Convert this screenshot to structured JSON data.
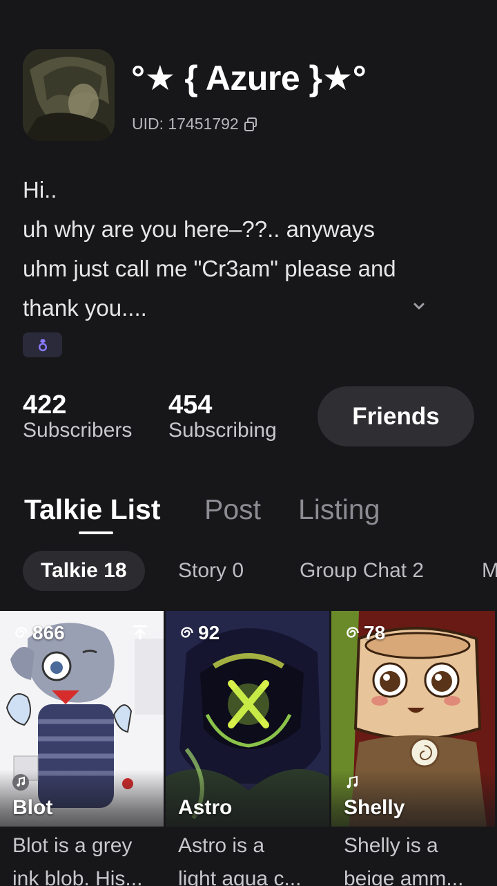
{
  "profile": {
    "name": "°★ { Azure }★°",
    "uid": "UID: 17451792",
    "bio_lines": [
      "Hi..",
      "uh why are you here–??.. anyways",
      "uhm just call me \"Cr3am\" please and",
      "thank you...."
    ]
  },
  "stats": [
    {
      "value": "422",
      "label": "Subscribers"
    },
    {
      "value": "454",
      "label": "Subscribing"
    }
  ],
  "friends_button": "Friends",
  "tabs": [
    {
      "label": "Talkie List",
      "active": true
    },
    {
      "label": "Post",
      "active": false
    },
    {
      "label": "Listing",
      "active": false
    }
  ],
  "chips": [
    {
      "label": "Talkie 18",
      "active": true
    },
    {
      "label": "Story 0",
      "active": false
    },
    {
      "label": "Group Chat 2",
      "active": false
    },
    {
      "label": "M",
      "active": false
    }
  ],
  "cards": [
    {
      "views": "866",
      "name": "Blot",
      "desc_lines": [
        "Blot is a grey",
        "ink blob. His..."
      ],
      "has_music": true,
      "pinned": true
    },
    {
      "views": "92",
      "name": "Astro",
      "desc_lines": [
        "Astro is a",
        "light aqua c..."
      ],
      "has_music": false,
      "pinned": false
    },
    {
      "views": "78",
      "name": "Shelly",
      "desc_lines": [
        "Shelly is a",
        "beige amm..."
      ],
      "has_music": true,
      "pinned": false
    }
  ],
  "colors": {
    "background": "#17171a",
    "button": "#2e2e33",
    "badge_icon": "#8a7cff"
  },
  "icons": {
    "copy": "copy-icon",
    "chevron": "chevron-down-icon",
    "badge": "ring-badge-icon",
    "views": "spiral-views-icon",
    "music": "music-note-icon",
    "pin": "pin-top-icon"
  }
}
